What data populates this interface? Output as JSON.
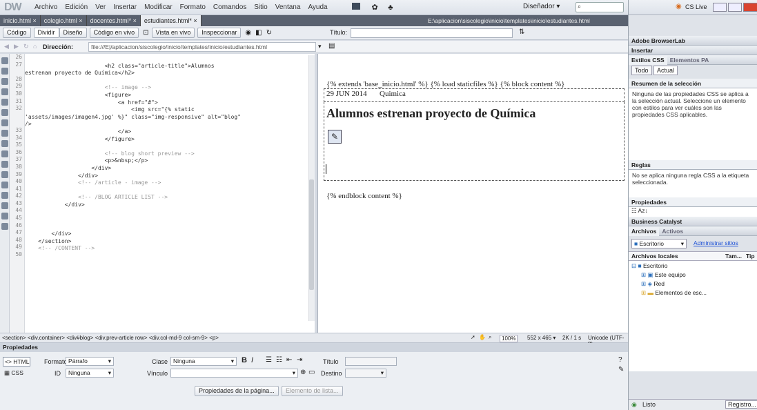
{
  "app": {
    "logo": "DW",
    "menus": [
      "Archivo",
      "Edición",
      "Ver",
      "Insertar",
      "Modificar",
      "Formato",
      "Comandos",
      "Sitio",
      "Ventana",
      "Ayuda"
    ],
    "workspace": "Diseñador ▾",
    "cslive": "CS Live"
  },
  "tabs": [
    {
      "label": "inicio.html ×",
      "active": false
    },
    {
      "label": "colegio.html ×",
      "active": false
    },
    {
      "label": "docentes.html* ×",
      "active": false
    },
    {
      "label": "estudiantes.html* ×",
      "active": true
    }
  ],
  "filepath": "E:\\aplicacion\\siscolegio\\inicio\\templates\\inicio\\estudiantes.html",
  "toolbar": {
    "code": "Código",
    "split": "Dividir",
    "design": "Diseño",
    "live_code": "Código en vivo",
    "live_view": "Vista en vivo",
    "inspect": "Inspeccionar",
    "title_label": "Título:"
  },
  "address": {
    "label": "Dirección:",
    "value": "file:///E|/aplicacion/siscolegio/inicio/templates/inicio/estudiantes.html"
  },
  "code": {
    "line_numbers": [
      "26",
      "27",
      "",
      "28",
      "29",
      "30",
      "31",
      "32",
      "",
      "",
      "33",
      "34",
      "35",
      "36",
      "37",
      "38",
      "39",
      "40",
      "41",
      "42",
      "43",
      "44",
      "45",
      "46",
      "47",
      "48",
      "49",
      "50"
    ],
    "lines": [
      {
        "t": "",
        "c": "tag"
      },
      {
        "t": "                        <h2 class=\"article-title\">Alumnos",
        "c": "tag"
      },
      {
        "t": "estrenan proyecto de Química</h2>",
        "c": "tag"
      },
      {
        "t": "",
        "c": "tag"
      },
      {
        "t": "                        <!-- image -->",
        "c": "cmt"
      },
      {
        "t": "                        <figure>",
        "c": "tag"
      },
      {
        "t": "                            <a href=\"#\">",
        "c": "tag"
      },
      {
        "t": "                                <img src=\"{% static",
        "c": "tag"
      },
      {
        "t": "'assets/images/imagen4.jpg' %}\" class=\"img-responsive\" alt=\"blog\"",
        "c": "tag"
      },
      {
        "t": "/>",
        "c": "tag"
      },
      {
        "t": "                            </a>",
        "c": "tag"
      },
      {
        "t": "                        </figure>",
        "c": "tag"
      },
      {
        "t": "",
        "c": "tag"
      },
      {
        "t": "                        <!-- blog short preview -->",
        "c": "cmt"
      },
      {
        "t": "                        <p>&nbsp;</p>",
        "c": "tag"
      },
      {
        "t": "                    </div>",
        "c": "tag"
      },
      {
        "t": "                </div>",
        "c": "tag"
      },
      {
        "t": "                <!-- /article - image -->",
        "c": "cmt"
      },
      {
        "t": "",
        "c": "tag"
      },
      {
        "t": "                <!-- /BLOG ARTICLE LIST -->",
        "c": "cmt"
      },
      {
        "t": "            </div>",
        "c": "tag"
      },
      {
        "t": "",
        "c": "tag"
      },
      {
        "t": "",
        "c": "tag"
      },
      {
        "t": "",
        "c": "tag"
      },
      {
        "t": "        </div>",
        "c": "tag"
      },
      {
        "t": "    </section>",
        "c": "tag"
      },
      {
        "t": "    <!-- /CONTENT -->",
        "c": "cmt"
      },
      {
        "t": "",
        "c": "tag"
      }
    ]
  },
  "design": {
    "template_tags": "{% extends 'base_inicio.html' %} {% load staticfiles %} {% block content %}",
    "date": "29 JUN 2014",
    "category": "Quimica",
    "heading": "Alumnos estrenan proyecto de Química",
    "endblock": "{% endblock content %}"
  },
  "status": {
    "breadcrumb": "<section> <div.container> <div#blog> <div.prev-article row> <div.col-md-9 col-sm-9> <p>",
    "zoom": "100%",
    "size": "552 x 465 ▾",
    "download": "2K / 1 s",
    "encoding": "Unicode (UTF-8)"
  },
  "properties": {
    "title": "Propiedades",
    "html": "HTML",
    "css": "CSS",
    "format_label": "Formato",
    "format_value": "Párrafo",
    "id_label": "ID",
    "id_value": "Ninguna",
    "class_label": "Clase",
    "class_value": "Ninguna",
    "link_label": "Vínculo",
    "title_label": "Título",
    "target_label": "Destino",
    "page_props": "Propiedades de la página...",
    "list_item": "Elemento de lista..."
  },
  "right": {
    "browserlab": "Adobe BrowserLab",
    "insert": "Insertar",
    "css_tab": "Estilos CSS",
    "ap_tab": "Elementos PA",
    "all": "Todo",
    "current": "Actual",
    "summary_title": "Resumen de la selección",
    "summary_text": "Ninguna de las propiedades CSS se aplica a la selección actual. Seleccione un elemento con estilos para ver cuáles son las propiedades CSS aplicables.",
    "rules_title": "Reglas",
    "rules_text": "No se aplica ninguna regla CSS a la etiqueta seleccionada.",
    "props_title": "Propiedades",
    "bc": "Business Catalyst",
    "files_tab": "Archivos",
    "assets_tab": "Activos",
    "desktop_select": "Escritorio",
    "manage": "Administrar sitios",
    "local_files": "Archivos locales",
    "col_size": "Tam...",
    "col_type": "Tip",
    "tree": [
      "Escritorio",
      "Este equipo",
      "Red",
      "Elementos de esc..."
    ],
    "ready": "Listo",
    "log": "Registro..."
  }
}
